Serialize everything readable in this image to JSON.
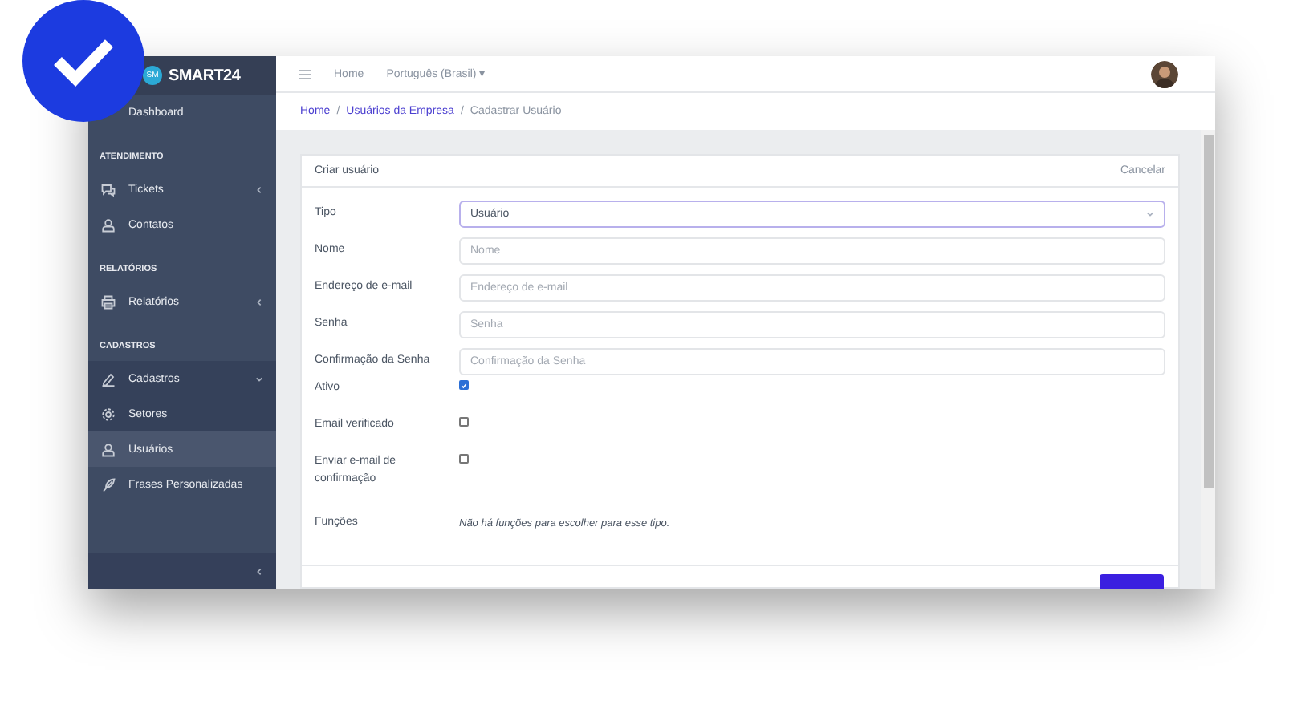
{
  "app": {
    "logo_badge": "SM",
    "logo_text": "SMART24"
  },
  "sidebar": {
    "items": [
      {
        "kind": "item",
        "label": "Dashboard",
        "selected": false,
        "expandable": false
      },
      {
        "kind": "heading",
        "label": "ATENDIMENTO"
      },
      {
        "kind": "item",
        "label": "Tickets",
        "selected": false,
        "expandable": true
      },
      {
        "kind": "item",
        "label": "Contatos",
        "selected": false,
        "expandable": false
      },
      {
        "kind": "heading",
        "label": "RELATÓRIOS"
      },
      {
        "kind": "item",
        "label": "Relatórios",
        "selected": false,
        "expandable": true
      },
      {
        "kind": "heading",
        "label": "CADASTROS"
      },
      {
        "kind": "item",
        "label": "Cadastros",
        "selected": false,
        "expandable": true,
        "expanded": true,
        "children": [
          {
            "label": "Setores",
            "selected": false
          },
          {
            "label": "Usuários",
            "selected": true
          }
        ]
      },
      {
        "kind": "item",
        "label": "Frases Personalizadas",
        "selected": false,
        "expandable": false
      }
    ]
  },
  "header": {
    "links": [
      "Home"
    ],
    "language": "Português (Brasil)",
    "language_caret": "▾"
  },
  "breadcrumb": [
    {
      "label": "Home",
      "link": true
    },
    {
      "separator": "/",
      "label": "Usuários da Empresa",
      "link": true
    },
    {
      "separator": "/",
      "label": "Cadastrar Usuário",
      "link": false
    }
  ],
  "card": {
    "title": "Criar usuário",
    "cancel": "Cancelar",
    "fields": [
      {
        "kind": "select",
        "label": "Tipo",
        "value": "Usuário"
      },
      {
        "kind": "text",
        "label": "Nome",
        "placeholder": "Nome"
      },
      {
        "kind": "text",
        "label": "Endereço de e-mail",
        "placeholder": "Endereço de e-mail"
      },
      {
        "kind": "text",
        "label": "Senha",
        "placeholder": "Senha"
      },
      {
        "kind": "text",
        "label": "Confirmação da Senha",
        "placeholder": "Confirmação da Senha"
      },
      {
        "kind": "checkbox",
        "label": "Ativo",
        "checked": true
      },
      {
        "kind": "checkbox",
        "label": "Email verificado",
        "checked": false
      },
      {
        "kind": "checkbox",
        "label": "Enviar e-mail de confirmação",
        "checked": false
      },
      {
        "kind": "note",
        "label": "Funções",
        "text": "Não há funções para escolher para esse tipo."
      }
    ]
  }
}
